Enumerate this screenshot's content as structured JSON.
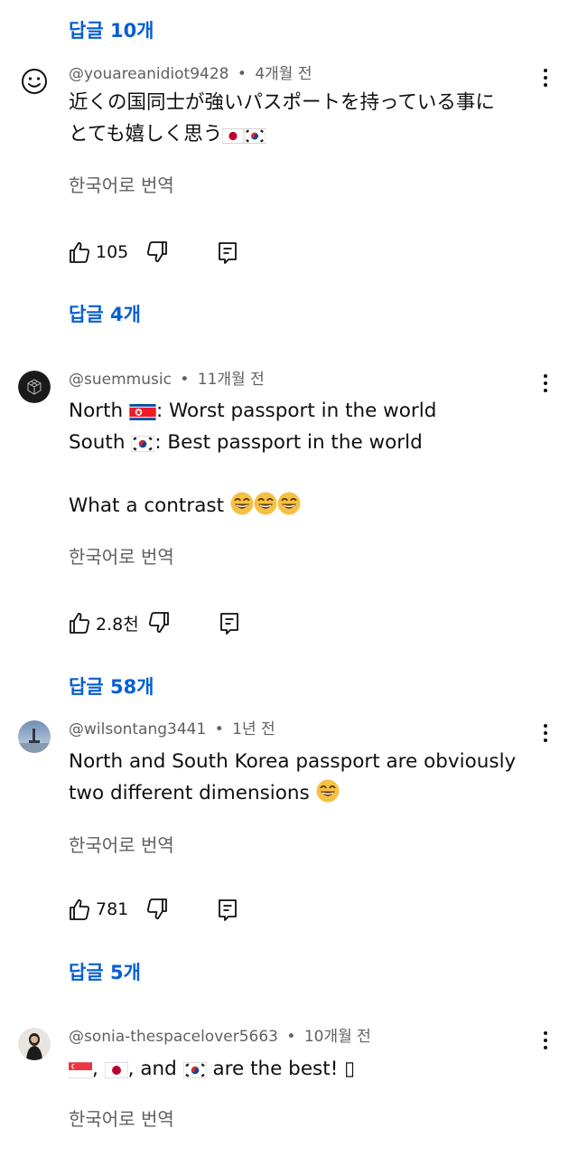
{
  "replies_links": [
    {
      "label": "답글 10개"
    },
    {
      "label": "답글 4개"
    },
    {
      "label": "답글 58개"
    },
    {
      "label": "답글 5개"
    }
  ],
  "comments": [
    {
      "author": "@youareanidiot9428",
      "separator": "•",
      "time": "4개월 전",
      "line1": "近くの国同士が強いパスポートを持っている事に",
      "line2": "とても嬉しく思う",
      "translate": "한국어로 번역",
      "likes": "105",
      "avatar_icon": "smiley-face-icon"
    },
    {
      "author": "@suemmusic",
      "separator": "•",
      "time": "11개월 전",
      "line1a": "North ",
      "line1b": ": Worst passport in the world",
      "line2a": "South ",
      "line2b": ": Best passport in the world",
      "line3": "What a contrast ",
      "translate": "한국어로 번역",
      "likes": "2.8천",
      "avatar_icon": "dark-logo-avatar"
    },
    {
      "author": "@wilsontang3441",
      "separator": "•",
      "time": "1년 전",
      "line1": "North and South Korea passport are obviously",
      "line2": "two different dimensions ",
      "translate": "한국어로 번역",
      "likes": "781",
      "avatar_icon": "landscape-photo-avatar"
    },
    {
      "author": "@sonia-thespacelover5663",
      "separator": "•",
      "time": "10개월 전",
      "text_comma1": ", ",
      "text_comma2": ", and ",
      "text_end": " are the best! ",
      "text_missing": "▯",
      "translate": "한국어로 번역",
      "avatar_icon": "person-photo-avatar"
    }
  ],
  "flags": {
    "japan": "japan-flag-icon",
    "korea": "south-korea-flag-icon",
    "north_korea": "north-korea-flag-icon",
    "singapore": "singapore-flag-icon"
  },
  "colors": {
    "link_blue": "#065fd4",
    "secondary_text": "#606060",
    "primary_text": "#0f0f0f"
  }
}
